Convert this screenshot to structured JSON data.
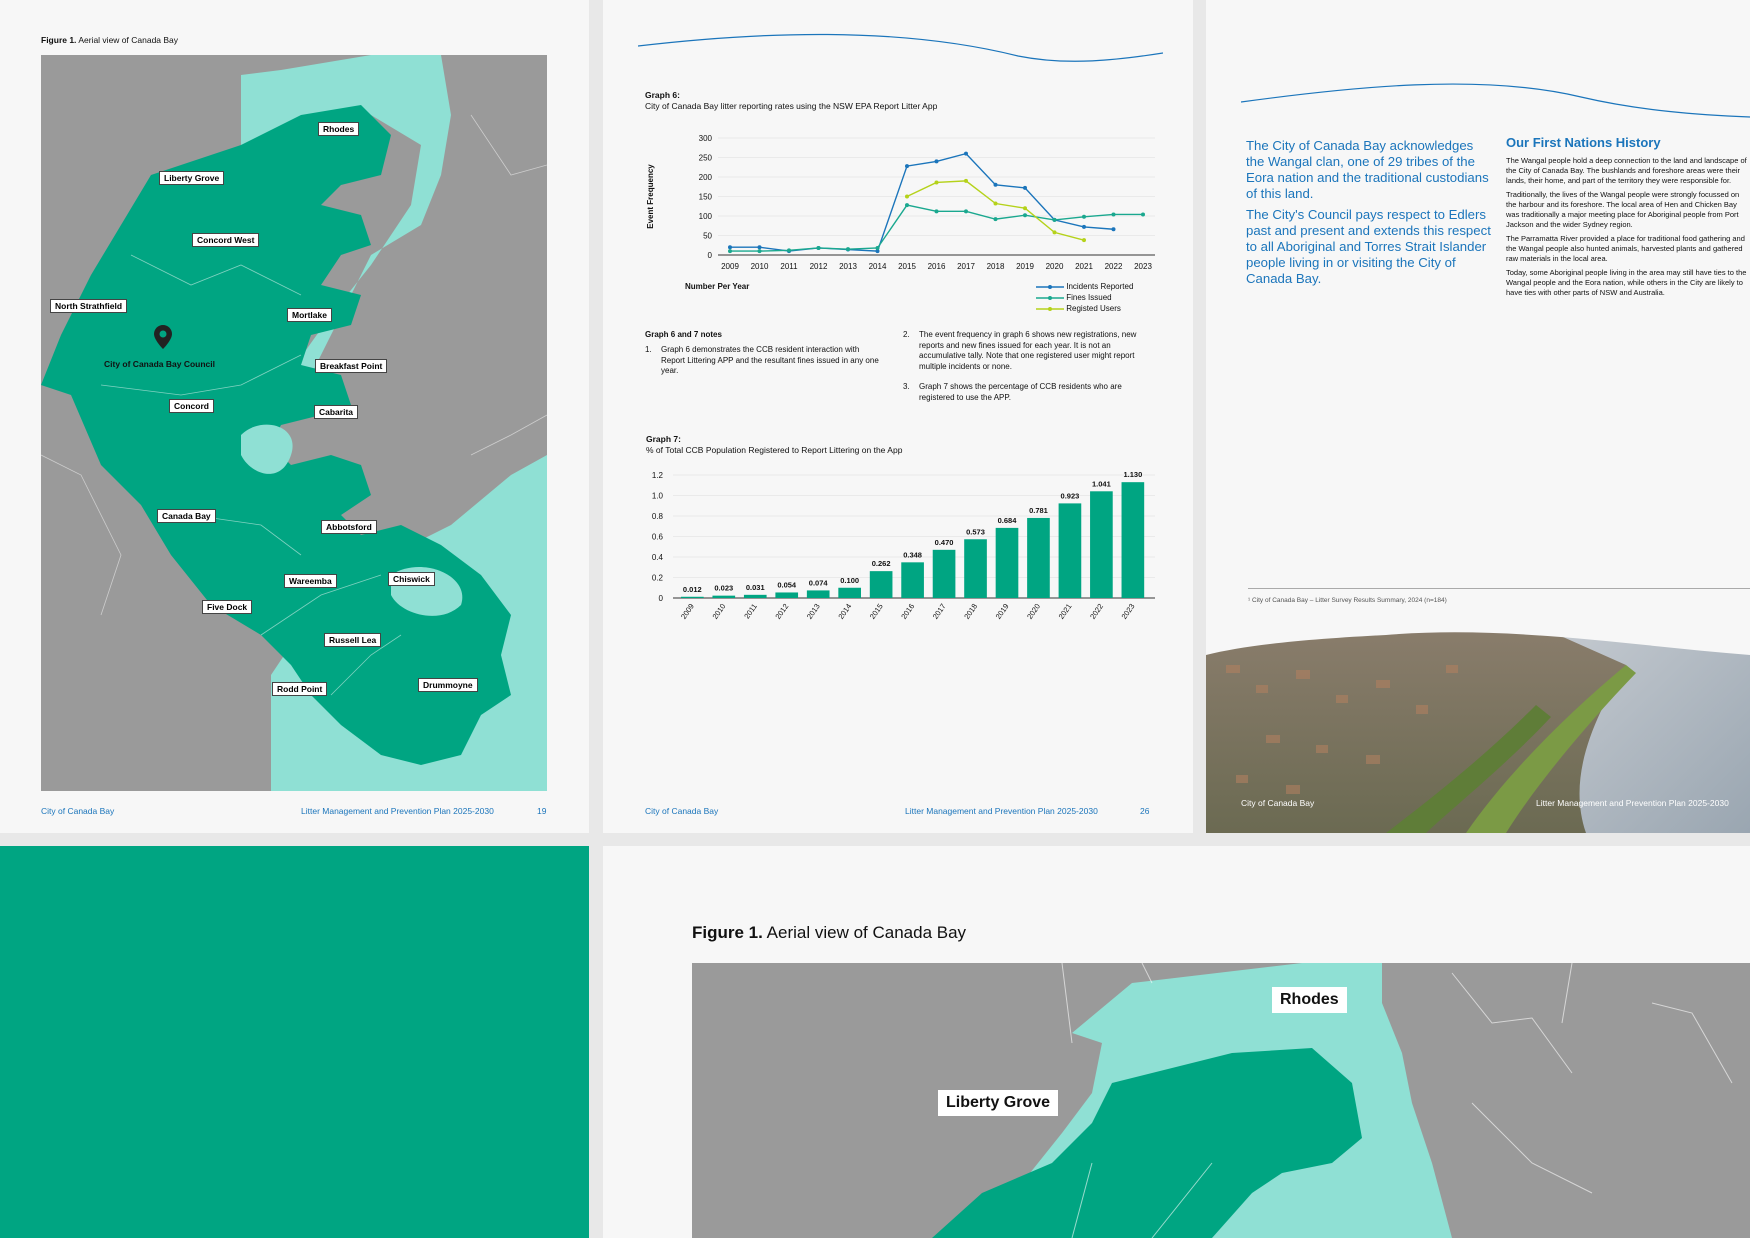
{
  "page1": {
    "figure_label": "Figure 1.",
    "figure_caption": "Aerial view of Canada Bay",
    "map_labels": {
      "rhodes": "Rhodes",
      "liberty_grove": "Liberty Grove",
      "concord_west": "Concord West",
      "north_strathfield": "North Strathfield",
      "mortlake": "Mortlake",
      "council": "City of Canada Bay Council",
      "breakfast_point": "Breakfast Point",
      "concord": "Concord",
      "cabarita": "Cabarita",
      "canada_bay": "Canada Bay",
      "abbotsford": "Abbotsford",
      "chiswick": "Chiswick",
      "wareemba": "Wareemba",
      "five_dock": "Five Dock",
      "russell_lea": "Russell Lea",
      "rodd_point": "Rodd Point",
      "drummoyne": "Drummoyne"
    },
    "footer_left": "City of Canada Bay",
    "footer_center": "Litter Management and Prevention Plan 2025-2030",
    "page_number": "19"
  },
  "page2": {
    "graph6_label": "Graph 6:",
    "graph6_title": "City of Canada Bay litter reporting rates using the NSW EPA Report Litter App",
    "graph7_label": "Graph 7:",
    "graph7_title": "% of Total CCB Population Registered to Report Littering on the App",
    "notes_title": "Graph 6 and 7 notes",
    "notes": [
      {
        "num": "1.",
        "text": "Graph 6 demonstrates the CCB resident interaction with Report Littering APP and the resultant fines issued in any one year."
      },
      {
        "num": "2.",
        "text": "The event frequency in graph 6 shows new registrations, new reports and new fines issued for each year. It is not an accumulative tally. Note that one registered user might report multiple incidents or none."
      },
      {
        "num": "3.",
        "text": "Graph 7 shows the percentage of CCB residents who are registered to use the APP."
      }
    ],
    "footer_left": "City of Canada Bay",
    "footer_center": "Litter Management and Prevention Plan 2025-2030",
    "page_number": "26"
  },
  "page3": {
    "ack_p1": "The City of Canada Bay acknowledges the Wangal clan, one of 29 tribes of the Eora nation and the traditional custodians of this land.",
    "ack_p2": "The City's Council pays respect to Edlers past and present and extends this respect to all Aboriginal and Torres Strait Islander people living in or visiting the City of Canada Bay.",
    "history_title": "Our First Nations History",
    "history_paragraphs": [
      "The Wangal people hold a deep connection to the land and landscape of the City of Canada Bay. The bushlands and foreshore areas were their lands, their home, and part of the territory they were responsible for.",
      "Traditionally, the lives of the Wangal people were strongly focussed on the harbour and its foreshore. The local area of Hen and Chicken Bay was traditionally a major meeting place for Aboriginal people from Port Jackson and the wider Sydney region.",
      "The Parramatta River provided a place for traditional food gathering and the Wangal people also hunted animals, harvested plants and gathered raw materials in the local area.",
      "Today, some Aboriginal people living in the area may still have ties to the Wangal people and the Eora nation, while others in the City are likely to have ties with other parts of NSW and Australia."
    ],
    "footnote": "¹ City of Canada Bay – Litter Survey Results Summary, 2024 (n=184)",
    "footer_left": "City of Canada Bay",
    "footer_right": "Litter Management and Prevention Plan 2025-2030"
  },
  "page5": {
    "figure_label": "Figure 1.",
    "figure_caption": "Aerial view of Canada Bay",
    "map_labels": {
      "rhodes": "Rhodes",
      "liberty_grove": "Liberty Grove"
    }
  },
  "colors": {
    "primary_green": "#00a582",
    "water": "#8fe0d4",
    "land_grey": "#9a9a9a",
    "brand_blue": "#1b75bb",
    "fines_teal": "#1aa88f",
    "users_lime": "#b5d21a"
  },
  "chart_data": [
    {
      "type": "line",
      "title": "City of Canada Bay litter reporting rates using the NSW EPA Report Litter App",
      "xlabel": "Number Per Year",
      "ylabel": "Event Frequency",
      "ylim": [
        0,
        300
      ],
      "yticks": [
        "0",
        "50",
        "100",
        "150",
        "200",
        "250",
        "300"
      ],
      "categories": [
        "2009",
        "2010",
        "2011",
        "2012",
        "2013",
        "2014",
        "2015",
        "2016",
        "2017",
        "2018",
        "2019",
        "2020",
        "2021",
        "2022",
        "2023"
      ],
      "legend_position": "bottom-right",
      "grid": true,
      "series": [
        {
          "name": "Incidents Reported",
          "color": "#1b75bb",
          "values": [
            20,
            20,
            10,
            18,
            14,
            10,
            228,
            240,
            260,
            180,
            172,
            90,
            72,
            66,
            null
          ]
        },
        {
          "name": "Fines Issued",
          "color": "#1aa88f",
          "values": [
            10,
            10,
            12,
            18,
            15,
            18,
            128,
            112,
            112,
            92,
            102,
            90,
            98,
            104,
            104
          ]
        },
        {
          "name": "Registed Users",
          "color": "#b5d21a",
          "values": [
            null,
            null,
            null,
            null,
            null,
            null,
            150,
            186,
            190,
            132,
            120,
            58,
            38,
            null,
            null
          ]
        }
      ]
    },
    {
      "type": "bar",
      "title": "% of Total CCB Population Registered to Report Littering on the App",
      "ylim": [
        0,
        1.2
      ],
      "yticks": [
        "0",
        "0.2",
        "0.4",
        "0.6",
        "0.8",
        "1.0",
        "1.2"
      ],
      "categories": [
        "2009",
        "2010",
        "2011",
        "2012",
        "2013",
        "2014",
        "2015",
        "2016",
        "2017",
        "2018",
        "2019",
        "2020",
        "2021",
        "2022",
        "2023"
      ],
      "values": [
        0.012,
        0.023,
        0.031,
        0.054,
        0.074,
        0.1,
        0.262,
        0.348,
        0.47,
        0.573,
        0.684,
        0.781,
        0.923,
        1.041,
        1.13
      ],
      "value_labels": [
        "0.012",
        "0.023",
        "0.031",
        "0.054",
        "0.074",
        "0.100",
        "0.262",
        "0.348",
        "0.470",
        "0.573",
        "0.684",
        "0.781",
        "0.923",
        "1.041",
        "1.130"
      ],
      "color": "#00a582",
      "grid": true
    }
  ]
}
